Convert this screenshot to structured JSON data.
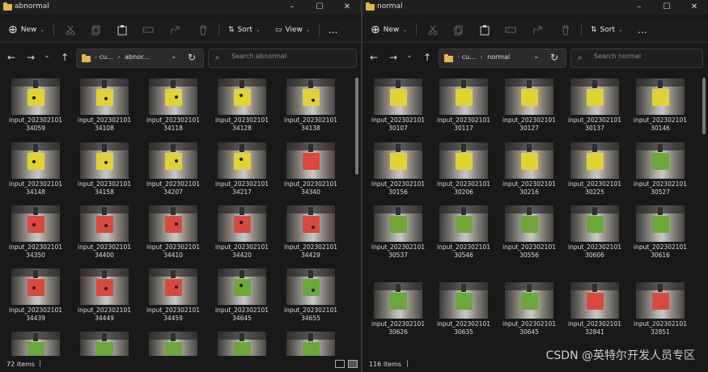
{
  "colors": {
    "yellow": "#e2d334",
    "red": "#d94a3c",
    "green": "#6aa83a"
  },
  "left": {
    "title": "abnormal",
    "buttons": {
      "new": "New",
      "sort": "Sort",
      "view": "View",
      "more": "..."
    },
    "address": {
      "root": "cu...",
      "current": "abnor..."
    },
    "search_placeholder": "Search abnormal",
    "status": "72 items",
    "files": [
      {
        "name": "input_2023021013 4059",
        "l1": "input_202302101",
        "l2": "34059",
        "color": "yellow",
        "dot": true
      },
      {
        "name": "input_2023021013 4108",
        "l1": "input_202302101",
        "l2": "34108",
        "color": "yellow",
        "dot": true
      },
      {
        "name": "input_2023021013 4118",
        "l1": "input_202302101",
        "l2": "34118",
        "color": "yellow",
        "dot": true
      },
      {
        "name": "input_2023021013 4128",
        "l1": "input_202302101",
        "l2": "34128",
        "color": "yellow",
        "dot": true
      },
      {
        "name": "input_2023021013 4138",
        "l1": "input_202302101",
        "l2": "34138",
        "color": "yellow",
        "dot": true
      },
      {
        "name": "input_2023021013 4148",
        "l1": "input_202302101",
        "l2": "34148",
        "color": "yellow",
        "dot": true
      },
      {
        "name": "input_2023021013 4158",
        "l1": "input_202302101",
        "l2": "34158",
        "color": "yellow",
        "dot": true
      },
      {
        "name": "input_2023021013 4207",
        "l1": "input_202302101",
        "l2": "34207",
        "color": "yellow",
        "dot": true
      },
      {
        "name": "input_2023021013 4217",
        "l1": "input_202302101",
        "l2": "34217",
        "color": "yellow",
        "dot": true
      },
      {
        "name": "input_2023021013 4340",
        "l1": "input_202302101",
        "l2": "34340",
        "color": "red",
        "dot": false
      },
      {
        "name": "input_2023021013 4350",
        "l1": "input_202302101",
        "l2": "34350",
        "color": "red",
        "dot": true
      },
      {
        "name": "input_2023021013 4400",
        "l1": "input_202302101",
        "l2": "34400",
        "color": "red",
        "dot": true
      },
      {
        "name": "input_2023021013 4410",
        "l1": "input_202302101",
        "l2": "34410",
        "color": "red",
        "dot": true
      },
      {
        "name": "input_2023021013 4420",
        "l1": "input_202302101",
        "l2": "34420",
        "color": "red",
        "dot": true
      },
      {
        "name": "input_2023021013 4429",
        "l1": "input_202302101",
        "l2": "34429",
        "color": "red",
        "dot": true
      },
      {
        "name": "input_2023021013 4439",
        "l1": "input_202302101",
        "l2": "34439",
        "color": "red",
        "dot": true
      },
      {
        "name": "input_2023021013 4449",
        "l1": "input_202302101",
        "l2": "34449",
        "color": "red",
        "dot": true
      },
      {
        "name": "input_2023021013 4459",
        "l1": "input_202302101",
        "l2": "34459",
        "color": "red",
        "dot": true
      },
      {
        "name": "input_2023021013 4645",
        "l1": "input_202302101",
        "l2": "34645",
        "color": "green",
        "dot": true
      },
      {
        "name": "input_2023021013 4655",
        "l1": "input_202302101",
        "l2": "34655",
        "color": "green",
        "dot": true
      },
      {
        "name": "",
        "l1": "",
        "l2": "",
        "color": "green",
        "dot": false
      },
      {
        "name": "",
        "l1": "",
        "l2": "",
        "color": "green",
        "dot": false
      },
      {
        "name": "",
        "l1": "",
        "l2": "",
        "color": "green",
        "dot": false
      },
      {
        "name": "",
        "l1": "",
        "l2": "",
        "color": "green",
        "dot": false
      },
      {
        "name": "",
        "l1": "",
        "l2": "",
        "color": "green",
        "dot": false
      }
    ]
  },
  "right": {
    "title": "normal",
    "buttons": {
      "new": "New",
      "sort": "Sort",
      "more": "..."
    },
    "address": {
      "root": "cu...",
      "current": "normal"
    },
    "search_placeholder": "Search normal",
    "status": "116 items",
    "files": [
      {
        "l1": "input_202302101",
        "l2": "30107",
        "color": "yellow"
      },
      {
        "l1": "input_202302101",
        "l2": "30117",
        "color": "yellow"
      },
      {
        "l1": "input_202302101",
        "l2": "30127",
        "color": "yellow"
      },
      {
        "l1": "input_202302101",
        "l2": "30137",
        "color": "yellow"
      },
      {
        "l1": "input_202302101",
        "l2": "30146",
        "color": "yellow"
      },
      {
        "l1": "input_202302101",
        "l2": "30156",
        "color": "yellow"
      },
      {
        "l1": "input_202302101",
        "l2": "30206",
        "color": "yellow"
      },
      {
        "l1": "input_202302101",
        "l2": "30216",
        "color": "yellow"
      },
      {
        "l1": "input_202302101",
        "l2": "30225",
        "color": "yellow"
      },
      {
        "l1": "input_202302101",
        "l2": "30527",
        "color": "green"
      },
      {
        "l1": "input_202302101",
        "l2": "30537",
        "color": "green"
      },
      {
        "l1": "input_202302101",
        "l2": "30546",
        "color": "green"
      },
      {
        "l1": "input_202302101",
        "l2": "30556",
        "color": "green"
      },
      {
        "l1": "input_202302101",
        "l2": "30606",
        "color": "green"
      },
      {
        "l1": "input_202302101",
        "l2": "30616",
        "color": "green"
      },
      {
        "l1": "input_202302101",
        "l2": "30626",
        "color": "green"
      },
      {
        "l1": "input_202302101",
        "l2": "30635",
        "color": "green"
      },
      {
        "l1": "input_202302101",
        "l2": "30645",
        "color": "green"
      },
      {
        "l1": "input_202302101",
        "l2": "32841",
        "color": "red"
      },
      {
        "l1": "input_202302101",
        "l2": "32851",
        "color": "red"
      }
    ]
  },
  "watermark": "CSDN @英特尔开发人员专区"
}
